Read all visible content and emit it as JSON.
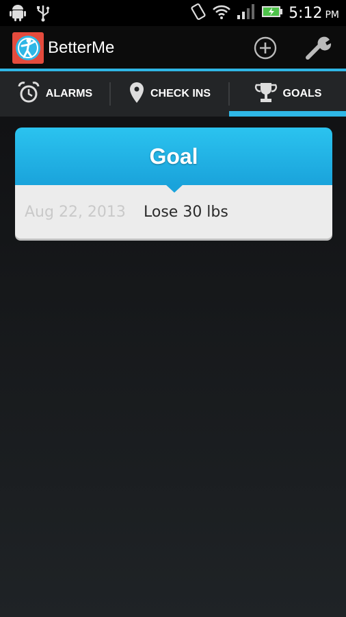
{
  "status_bar": {
    "time": "5:12",
    "ampm": "PM",
    "icons": [
      "android-icon",
      "usb-icon",
      "rotate-icon",
      "wifi-icon",
      "signal-icon",
      "battery-icon"
    ]
  },
  "action_bar": {
    "app_title": "BetterMe",
    "add_icon": "add-circle-icon",
    "settings_icon": "wrench-icon"
  },
  "tabs": [
    {
      "label": "ALARMS",
      "icon": "alarm-clock-icon",
      "selected": false
    },
    {
      "label": "CHECK INS",
      "icon": "map-pin-icon",
      "selected": false
    },
    {
      "label": "GOALS",
      "icon": "trophy-icon",
      "selected": true
    }
  ],
  "goal_card": {
    "title": "Goal",
    "date": "Aug 22, 2013",
    "text": "Lose 30 lbs"
  },
  "colors": {
    "accent": "#2fb7e6",
    "brand_icon_bg": "#e44b3d",
    "card_header": "#1aa3db",
    "card_body": "#ececec"
  }
}
